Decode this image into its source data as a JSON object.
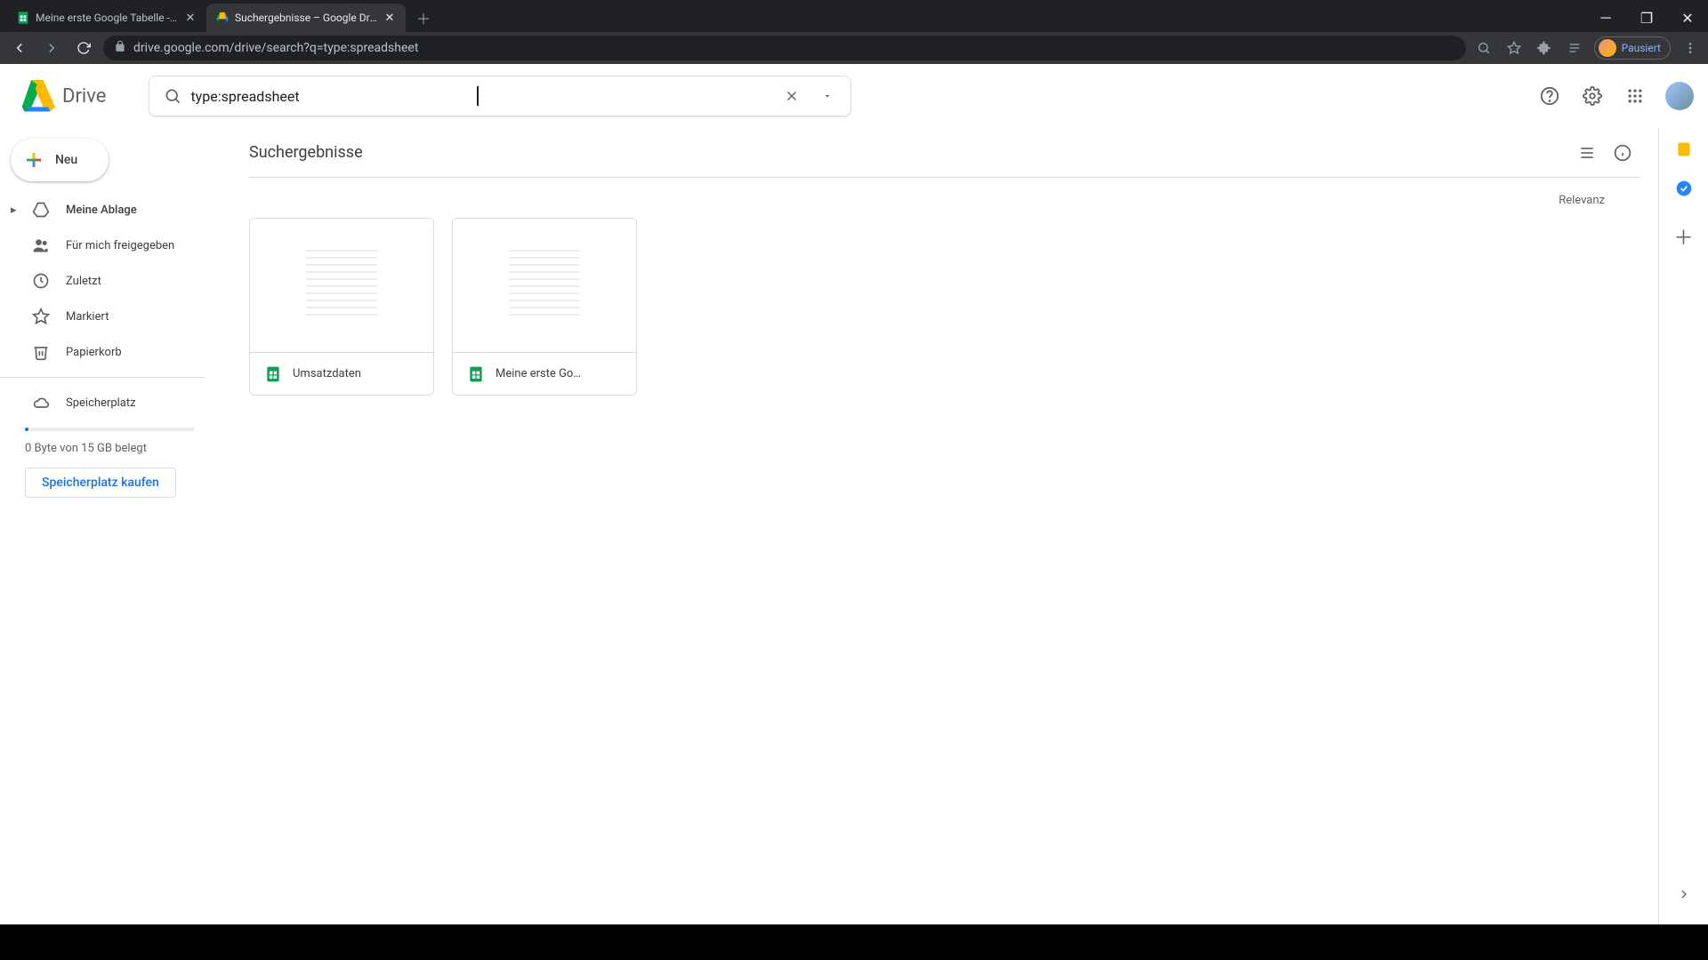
{
  "browser": {
    "tabs": [
      {
        "title": "Meine erste Google Tabelle - Go",
        "active": false
      },
      {
        "title": "Suchergebnisse – Google Drive",
        "active": true
      }
    ],
    "url": "drive.google.com/drive/search?q=type:spreadsheet",
    "profile_label": "Pausiert"
  },
  "drive": {
    "product_name": "Drive",
    "search_value": "type:spreadsheet",
    "new_button": "Neu",
    "nav": {
      "my_drive": "Meine Ablage",
      "shared": "Für mich freigegeben",
      "recent": "Zuletzt",
      "starred": "Markiert",
      "trash": "Papierkorb",
      "storage": "Speicherplatz"
    },
    "storage_text": "0 Byte von 15 GB belegt",
    "buy_storage": "Speicherplatz kaufen",
    "content": {
      "title": "Suchergebnisse",
      "sort": "Relevanz",
      "files": [
        {
          "name": "Umsatzdaten"
        },
        {
          "name": "Meine erste Go…"
        }
      ]
    }
  }
}
